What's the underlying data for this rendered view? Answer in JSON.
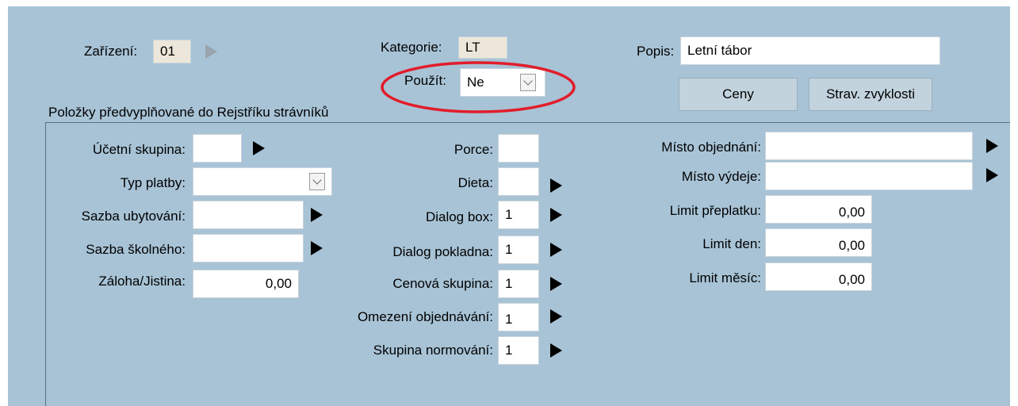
{
  "header": {
    "zarizeni_label": "Zařízení:",
    "zarizeni_value": "01",
    "kategorie_label": "Kategorie:",
    "kategorie_value": "LT",
    "pouzit_label": "Použít:",
    "pouzit_value": "Ne",
    "popis_label": "Popis:",
    "popis_value": "Letní tábor",
    "ceny_button": "Ceny",
    "strav_button": "Strav. zvyklosti",
    "annotation_color": "#e11d2a"
  },
  "group": {
    "title": "Položky předvyplňované do Rejstříku strávníků"
  },
  "left": {
    "ucetni_label": "Účetní skupina:",
    "ucetni_value": "",
    "typ_platby_label": "Typ platby:",
    "typ_platby_value": "",
    "ubytovani_label": "Sazba ubytování:",
    "ubytovani_value": "",
    "skolneho_label": "Sazba školného:",
    "skolneho_value": "",
    "zaloha_label": "Záloha/Jistina:",
    "zaloha_value": "0,00"
  },
  "middle": {
    "porce_label": "Porce:",
    "porce_value": "",
    "dieta_label": "Dieta:",
    "dieta_value": "",
    "dialog_box_label": "Dialog box:",
    "dialog_box_value": "1",
    "dialog_pokladna_label": "Dialog pokladna:",
    "dialog_pokladna_value": "1",
    "cenova_label": "Cenová skupina:",
    "cenova_value": "1",
    "omezeni_label": "Omezení objednávání:",
    "omezeni_value": "1",
    "normovani_label": "Skupina normování:",
    "normovani_value": "1"
  },
  "right": {
    "misto_objednani_label": "Místo objednání:",
    "misto_objednani_value": "",
    "misto_vydeje_label": "Místo výdeje:",
    "misto_vydeje_value": "",
    "limit_preplatku_label": "Limit přeplatku:",
    "limit_preplatku_value": "0,00",
    "limit_den_label": "Limit den:",
    "limit_den_value": "0,00",
    "limit_mesic_label": "Limit měsíc:",
    "limit_mesic_value": "0,00"
  }
}
